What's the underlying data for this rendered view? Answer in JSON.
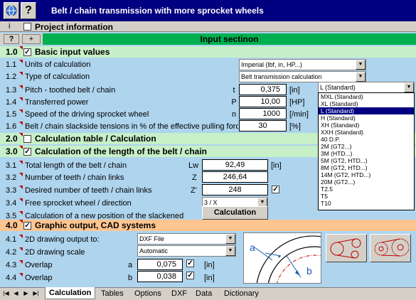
{
  "window": {
    "title": "Belt / chain transmission with more sprocket wheels"
  },
  "rows": {
    "info": {
      "i": "i",
      "label": "Project information"
    },
    "input": {
      "q": "?",
      "plus": "+",
      "label": "Input sectinon"
    },
    "s10": {
      "num": "1.0",
      "label": "Basic input values"
    },
    "r11": {
      "num": "1.1",
      "label": "Units of calculation",
      "value": "Imperial (lbf, in, HP...)"
    },
    "r12": {
      "num": "1.2",
      "label": "Type of calculation",
      "value": "Belt transmission calculation"
    },
    "r13": {
      "num": "1.3",
      "label": "Pitch - toothed belt / chain",
      "sym": "t",
      "value": "0,375",
      "unit": "[in]",
      "combo": "L (Standard)"
    },
    "r14": {
      "num": "1.4",
      "label": "Transferred power",
      "sym": "P",
      "value": "10,00",
      "unit": "[HP]"
    },
    "r15": {
      "num": "1.5",
      "label": "Speed of the driving sprocket wheel",
      "sym": "n",
      "value": "1000",
      "unit": "[/min]"
    },
    "r16": {
      "num": "1.6",
      "label": "Belt / chain slackside tensions in % of the effective pulling force",
      "value": "30",
      "unit": "[%]"
    },
    "s20": {
      "num": "2.0",
      "label": "Calculation table / Calculation"
    },
    "s30": {
      "num": "3.0",
      "label": "Calculation of the length of the belt / chain"
    },
    "r31": {
      "num": "3.1",
      "label": "Total length of the belt / chain",
      "sym": "Lw",
      "value": "92,49",
      "unit": "[in]"
    },
    "r32": {
      "num": "3.2",
      "label": "Number of teeth / chain links",
      "sym": "Z",
      "value": "246,64"
    },
    "r33": {
      "num": "3.3",
      "label": "Desired number of teeth / chain links",
      "sym": "Z'",
      "value": "248"
    },
    "r34": {
      "num": "3.4",
      "label": "Free sprocket wheel / direction",
      "value": "3 / X"
    },
    "r35": {
      "num": "3.5",
      "label": "Calculation of a new position of the slackened wheel",
      "button": "Calculation"
    },
    "s40": {
      "num": "4.0",
      "label": "Graphic output, CAD systems"
    },
    "r41": {
      "num": "4.1",
      "label": "2D drawing output to:",
      "value": "DXF File"
    },
    "r42": {
      "num": "4.2",
      "label": "2D drawing scale",
      "value": "Automatic"
    },
    "r43": {
      "num": "4.3",
      "label": "Overlap",
      "sym": "a",
      "value": "0,075",
      "unit": "[in]"
    },
    "r44": {
      "num": "4.4",
      "label": "Overlap",
      "sym": "b",
      "value": "0,038",
      "unit": "[in]"
    }
  },
  "pitch_options": [
    "MXL (Standard)",
    "XL (Standard)",
    "L (Standard)",
    "H (Standard)",
    "XH (Standard)",
    "XXH (Standard)",
    "40 D.P.",
    "2M (GT2...)",
    "3M (HTD...)",
    "5M  (GT2, HTD...)",
    "8M (GT2, HTD...)",
    "14M (GT2, HTD...)",
    "20M (GT2...)",
    "T2.5",
    "T5",
    "T10"
  ],
  "pitch_selected_index": 2,
  "diagram": {
    "a": "a",
    "b": "b"
  },
  "tabs": [
    "Calculation",
    "Tables",
    "Options",
    "DXF",
    "Data",
    "Dictionary"
  ],
  "active_tab": "Calculation",
  "colors": {
    "title_bg": "#000080",
    "body_bg": "#aed4ee",
    "section_green": "#c8f0c8",
    "section_orange": "#ffc591",
    "input_row": "#00b050"
  }
}
